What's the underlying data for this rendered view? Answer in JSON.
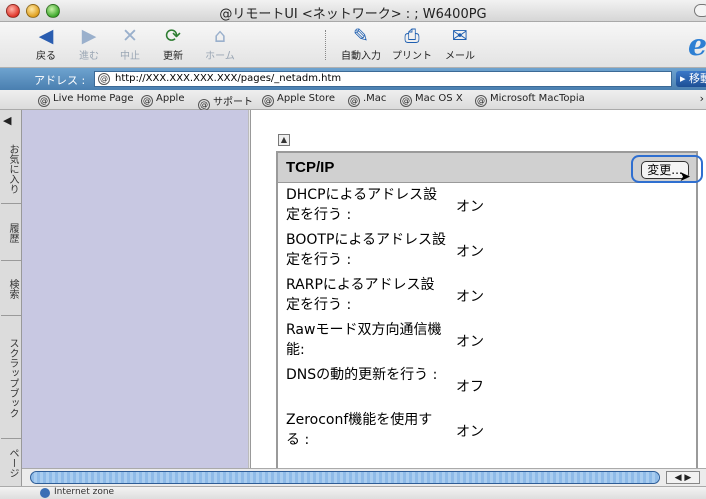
{
  "window": {
    "title": "@リモートUI <ネットワーク> : ; W6400PG"
  },
  "toolbar": {
    "buttons": [
      {
        "label": "戻る",
        "icon": "back-arrow-icon",
        "glyph": "◀",
        "enabled": true,
        "color": "#2a5db0"
      },
      {
        "label": "進む",
        "icon": "forward-arrow-icon",
        "glyph": "▶",
        "enabled": false,
        "color": "#9ab0cc"
      },
      {
        "label": "中止",
        "icon": "stop-icon",
        "glyph": "✕",
        "enabled": false,
        "color": "#9ab0cc"
      },
      {
        "label": "更新",
        "icon": "refresh-icon",
        "glyph": "⟳",
        "enabled": true,
        "color": "#2e7d32"
      },
      {
        "label": "ホーム",
        "icon": "home-icon",
        "glyph": "⌂",
        "enabled": false,
        "color": "#9ab0cc"
      },
      {
        "label": "自動入力",
        "icon": "autofill-icon",
        "glyph": "✎",
        "enabled": true,
        "color": "#1f5fb0"
      },
      {
        "label": "プリント",
        "icon": "printer-icon",
        "glyph": "⎙",
        "enabled": true,
        "color": "#1f5fb0"
      },
      {
        "label": "メール",
        "icon": "mail-icon",
        "glyph": "✉",
        "enabled": true,
        "color": "#1f5fb0"
      }
    ]
  },
  "address": {
    "label": "アドレス :",
    "url": "http://XXX.XXX.XXX.XXX/pages/_netadm.htm",
    "go_label": "▸ 移動"
  },
  "favorites": [
    "Live Home Page",
    "Apple",
    "サポート",
    "Apple Store",
    ".Mac",
    "Mac OS X",
    "Microsoft MacTopia"
  ],
  "sidebar_tabs": [
    "お気に入り",
    "履歴",
    "検索",
    "スクラップブック",
    "ページ"
  ],
  "panel": {
    "title": "TCP/IP",
    "edit_label": "変更...",
    "rows": [
      {
        "label": "DHCPによるアドレス設定を行う :",
        "value": "オン"
      },
      {
        "label": "BOOTPによるアドレス設定を行う :",
        "value": "オン"
      },
      {
        "label": "RARPによるアドレス設定を行う :",
        "value": "オン"
      },
      {
        "label": "Rawモード双方向通信機能:",
        "value": "オン"
      },
      {
        "label": "DNSの動的更新を行う :",
        "value": "オフ"
      },
      {
        "label": "Zeroconf機能を使用する :",
        "value": "オン"
      }
    ]
  },
  "status": {
    "text": "Internet zone"
  },
  "colors": {
    "left_frame": "#c8c8e2",
    "accent": "#2f6fd0"
  }
}
